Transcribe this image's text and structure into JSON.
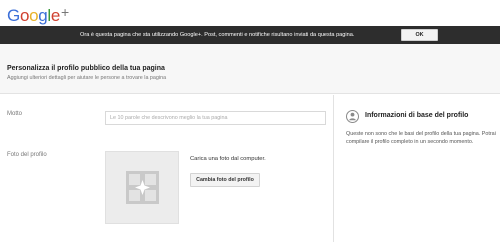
{
  "app": {
    "logo_text": "Google+"
  },
  "notice": {
    "text": "Ora è questa pagina che sta utilizzando Google+. Post, commenti e notifiche risultano inviati da questa pagina.",
    "ok_label": "OK"
  },
  "header": {
    "title": "Personalizza il profilo pubblico della tua pagina",
    "subtitle": "Aggiungi ulteriori dettagli per aiutare le persone a trovare la pagina"
  },
  "form": {
    "motto_label": "Motto",
    "motto_value": "",
    "motto_placeholder": "Le 10 parole che descrivono meglio la tua pagina",
    "photo_label": "Foto del profilo",
    "upload_text": "Carica una foto dal computer.",
    "change_photo_label": "Cambia foto del profilo"
  },
  "side": {
    "title": "Informazioni di base del profilo",
    "body": "Queste non sono che le basi del profilo della tua pagina. Potrai compilare il profilo completo in un secondo momento."
  },
  "icons": {
    "info": "person-info-icon",
    "photo_placeholder": "photo-placeholder-icon"
  }
}
